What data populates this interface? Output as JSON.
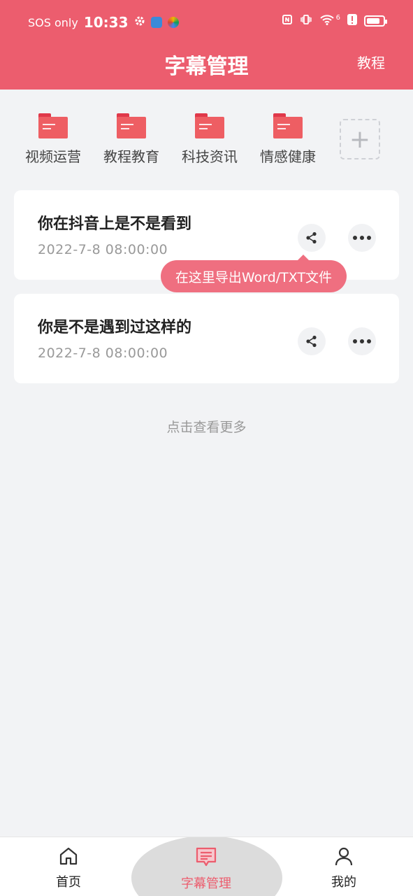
{
  "status_bar": {
    "carrier": "SOS only",
    "time": "10:33",
    "network": "6"
  },
  "header": {
    "title": "字幕管理",
    "tutorial_label": "教程"
  },
  "folders": [
    {
      "label": "视频运营"
    },
    {
      "label": "教程教育"
    },
    {
      "label": "科技资讯"
    },
    {
      "label": "情感健康"
    }
  ],
  "add_folder": {
    "symbol": "+"
  },
  "subtitles": [
    {
      "name": "你在抖音上是不是看到",
      "date": "2022-7-8   08:00:00"
    },
    {
      "name": "你是不是遇到过这样的",
      "date": "2022-7-8   08:00:00"
    }
  ],
  "tooltip": "在这里导出Word/TXT文件",
  "load_more": "点击查看更多",
  "bottom_nav": {
    "items": [
      {
        "label": "首页"
      },
      {
        "label": "字幕管理"
      },
      {
        "label": "我的"
      }
    ],
    "active_index": 1
  },
  "colors": {
    "brand": "#ec5d6e",
    "folder": "#ee5e63",
    "tooltip": "#ef6f80"
  }
}
